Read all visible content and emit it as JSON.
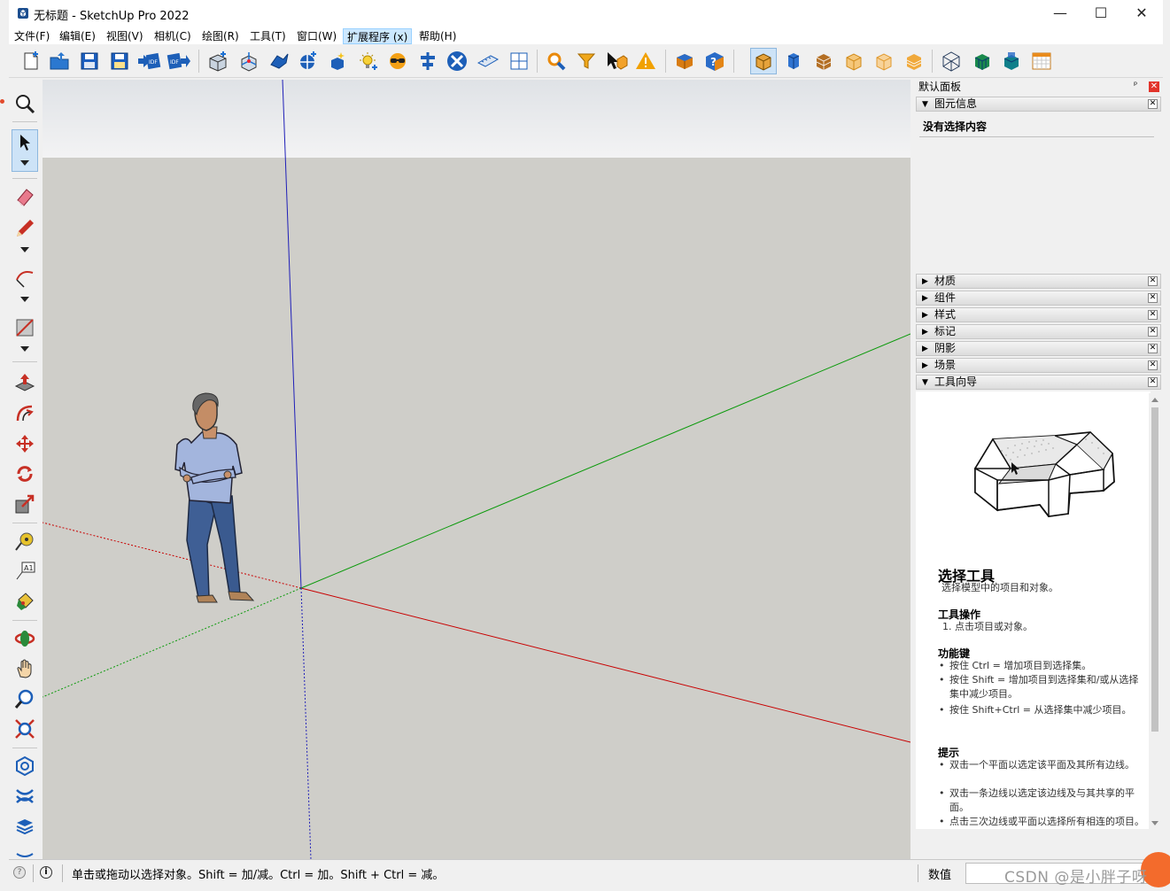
{
  "window": {
    "title": "无标题 - SketchUp Pro 2022",
    "minimize": "—",
    "maximize": "☐",
    "close": "✕"
  },
  "menu": [
    {
      "label": "文件(F)"
    },
    {
      "label": "编辑(E)"
    },
    {
      "label": "视图(V)"
    },
    {
      "label": "相机(C)"
    },
    {
      "label": "绘图(R)"
    },
    {
      "label": "工具(T)"
    },
    {
      "label": "窗口(W)"
    },
    {
      "label": "扩展程序 (x)",
      "active": true
    },
    {
      "label": "帮助(H)"
    }
  ],
  "toolbar_icons": [
    "new-file-icon",
    "open-folder-icon",
    "save-icon",
    "save-as-icon",
    "idf-import-icon",
    "idf-export-icon",
    "component-add-icon",
    "component-axes-icon",
    "rotate-component-icon",
    "component-edit-icon",
    "component-sparkle-icon",
    "light-bulb-icon",
    "sun-glasses-icon",
    "align-icon",
    "tools-cross-icon",
    "ruler-plane-icon",
    "grid-window-icon",
    "search-zoom-icon",
    "filter-funnel-icon",
    "select-cursor-icon",
    "warning-icon",
    "blue-cube-icon",
    "help-cube-icon",
    "iso-view-icon",
    "front-view-icon",
    "texture-box-icon",
    "wireframe-box-icon",
    "hidden-line-box-icon",
    "shaded-box-icon",
    "xray-box-icon",
    "monochrome-box-icon",
    "section-cube-icon",
    "calendar-grid-icon"
  ],
  "left_tools": [
    "zoom-icon",
    "select-arrow-icon",
    "eraser-icon",
    "pencil-icon",
    "arc-icon",
    "rectangle-icon",
    "push-pull-icon",
    "offset-icon",
    "move-icon",
    "rotate-icon",
    "scale-icon",
    "tape-measure-icon",
    "text-label-icon",
    "paint-bucket-icon",
    "orbit-icon",
    "pan-hand-icon",
    "zoom-window-icon",
    "zoom-extents-icon",
    "warehouse-icon",
    "extension-icon",
    "layers-icon"
  ],
  "tray": {
    "title": "默认面板",
    "pin": "ᵖ",
    "close": "✕",
    "entity_info": {
      "header": "图元信息",
      "content": "没有选择内容"
    },
    "collapsed_panels": [
      "材质",
      "组件",
      "样式",
      "标记",
      "阴影",
      "场景"
    ],
    "instructor_header": "工具向导",
    "instructor": {
      "title": "选择工具",
      "subtitle": "选择模型中的项目和对象。",
      "operation_heading": "工具操作",
      "operation_steps": [
        "1. 点击项目或对象。"
      ],
      "modifier_heading": "功能键",
      "modifier_items": [
        "按住 Ctrl = 增加项目到选择集。",
        "按住 Shift = 增加项目到选择集和/或从选择集中减少项目。",
        "按住 Shift+Ctrl = 从选择集中减少项目。"
      ],
      "tips_heading": "提示",
      "tips_items": [
        "双击一个平面以选定该平面及其所有边线。",
        "双击一条边线以选定该边线及与其共享的平面。",
        "点击三次边线或平面以选择所有相连的项目。"
      ]
    }
  },
  "status": {
    "message": "单击或拖动以选择对象。Shift = 加/减。Ctrl = 加。Shift + Ctrl = 减。",
    "measure_label": "数值",
    "measure_value": "",
    "watermark": "CSDN @是小胖子呀"
  },
  "colors": {
    "sky": "#e6e7e9",
    "ground": "#cfcec9",
    "axis_red": "#c80000",
    "axis_green": "#0b9a0b",
    "axis_blue": "#1f1fb8",
    "selected_tool": "#cde3f7"
  }
}
